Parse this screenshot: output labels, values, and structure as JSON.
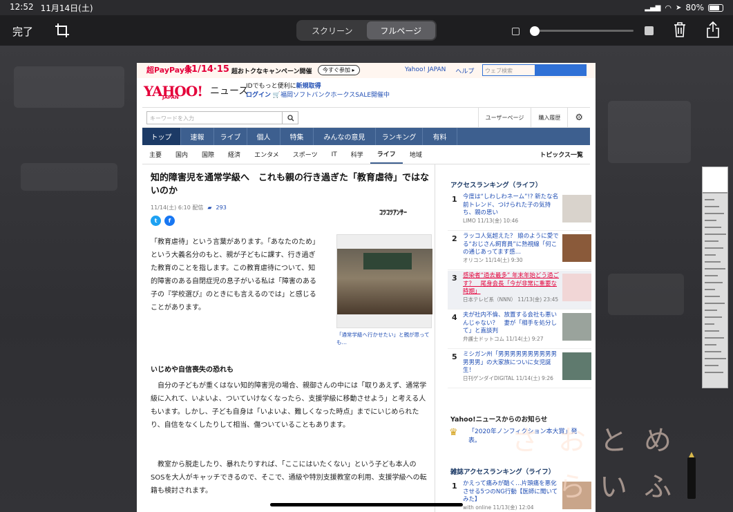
{
  "status": {
    "time": "12:52",
    "date": "11月14日(土)",
    "battery": "80%",
    "battery_level": 0.8
  },
  "toolbar": {
    "done": "完了",
    "segments": [
      "スクリーン",
      "フルページ"
    ],
    "active_segment": 1,
    "opacity_level": 0.0
  },
  "promo": {
    "logo": "超PayPay祭",
    "dates": "11/14·15",
    "msg": "超おトクなキャンペーン開催",
    "cta": "今すぐ参加 ▸"
  },
  "header": {
    "links": [
      "Yahoo! JAPAN",
      "ヘルプ"
    ],
    "search_placeholder": "ウェブ検索",
    "brand": "YAHOO!",
    "brand_sub": "JAPAN",
    "brand_news": "ニュース",
    "id_line1": "IDでもっと便利に",
    "id_new": "新規取得",
    "login": "ログイン",
    "promo_line": "福岡ソフトバンクホークスSALE開催中"
  },
  "searchrow": {
    "placeholder": "キーワードを入力",
    "tabs": [
      "ユーザーページ",
      "購入履歴"
    ]
  },
  "mainnav": [
    "トップ",
    "速報",
    "ライブ",
    "個人",
    "特集",
    "みんなの意見",
    "ランキング",
    "有料"
  ],
  "subnav": [
    "主要",
    "国内",
    "国際",
    "経済",
    "エンタメ",
    "スポーツ",
    "IT",
    "科学",
    "ライフ",
    "地域"
  ],
  "subnav_active": "ライフ",
  "subnav_topics": "トピックス一覧",
  "article": {
    "title": "知的障害児を通常学級へ　これも親の行き過ぎた「教育虐待」ではないのか",
    "date": "11/14(土) 6:10 配信",
    "comments": "293",
    "publisher": "ｺﾂｺﾂｱﾝｻｰ",
    "body1": "「教育虐待」という言葉があります。「あなたのため」という大義名分のもと、親が子どもに課す、行き過ぎた教育のことを指します。この教育虐待について、知的障害のある自閉症児の息子がいる私は「障害のある子の『学校選び』のときにも言えるのでは」と感じることがあります。",
    "image_caption": "「通常学級へ行かせたい」と親が思っても…",
    "subhead": "いじめや自信喪失の恐れも",
    "body2": "自分の子どもが重くはない知的障害児の場合、親御さんの中には「取りあえず、通常学級に入れて、いよいよ、ついていけなくなったら、支援学級に移動させよう」と考える人もいます。しかし、子ども自身は「いよいよ、難しくなった時点」までにいじめられたり、自信をなくしたりして相当、傷ついていることもあります。",
    "body3": "教室から脱走したり、暴れたりすれば、「ここにはいたくない」という子ども本人のSOSを大人がキャッチできるので、そこで、通級や特別支援教室の利用、支援学級への転籍も検討されます。"
  },
  "sidebar": {
    "ranking_title": "アクセスランキング（ライフ）",
    "items": [
      {
        "num": "1",
        "text": "今度は“しわしわネーム”!? 新たな名前トレンド、つけられた子の気持ち、親の思い",
        "source": "LIMO 11/13(金) 10:46"
      },
      {
        "num": "2",
        "text": "ラッコ人気超えた？ 娘のように愛でる“おじさん飼育員”に熱視線「何この通じあってます感…",
        "source": "オリコン 11/14(土) 9:30"
      },
      {
        "num": "3",
        "text": "感染者“過去最多” 年末年始どう過ごす？　尾身会長「今が非常に重要な時期」",
        "source": "日本テレビ系（NNN） 11/13(金) 23:45"
      },
      {
        "num": "4",
        "text": "夫が社内不倫、放置する会社も悪いんじゃない？　妻が「相手を処分して」と直談判",
        "source": "弁護士ドットコム 11/14(土) 9:27"
      },
      {
        "num": "5",
        "text": "ミシガン州「男男男男男男男男男男男男男」の大家族についに女児誕生！",
        "source": "日刊ゲンダイDIGITAL 11/14(土) 9:26"
      }
    ],
    "notice_title": "Yahoo!ニュースからのお知らせ",
    "notice_item": "「2020年ノンフィクション本大賞」発表。",
    "magazine_title": "雑誌アクセスランキング（ライフ）",
    "mag_item": {
      "num": "1",
      "text": "かえって痛みが酷く…片頭痛を悪化させる5つのNG行動【医師に聞いてみた】",
      "source": "with online 11/13(金) 12:04"
    }
  },
  "watermark": [
    "さ",
    "お",
    "と",
    "め",
    "ら",
    "い",
    "ふ"
  ]
}
